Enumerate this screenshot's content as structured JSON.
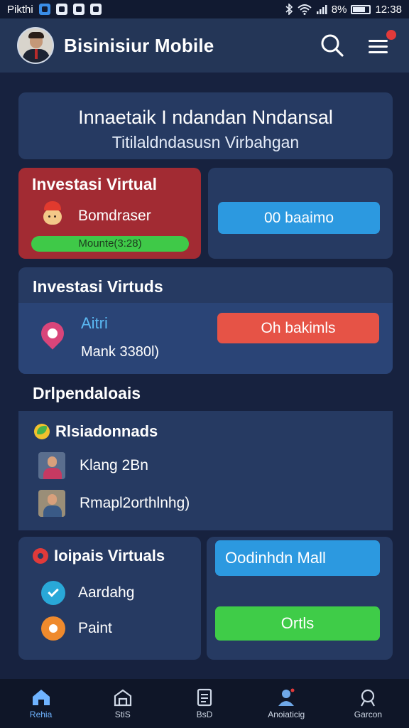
{
  "status_bar": {
    "left_text": "Pikthi",
    "battery": "8%",
    "battery_level": 0.7,
    "time": "12:38"
  },
  "app_bar": {
    "title": "Bisinisiur Mobile"
  },
  "headline": {
    "title": "Innaetaik I ndandan Nndansal",
    "subtitle": "Titilaldndasusn Virbahgan"
  },
  "featured": {
    "title": "Investasi Virtual",
    "item_label": "Bomdraser",
    "pill": "Mounte(3:28)",
    "button": "00 baaimo"
  },
  "investment": {
    "title": "Investasi Virtuds",
    "name": "Aitri",
    "value": "Mank 3380l)",
    "button": "Oh bakimls"
  },
  "section": {
    "title": "Drlpendaloais"
  },
  "list": {
    "header": "Rlsiadonnads",
    "rows": [
      {
        "label": "Klang 2Bn"
      },
      {
        "label": "Rmapl2orthlnhg)"
      }
    ]
  },
  "bottom_left": {
    "title": "Ioipais Virtuals",
    "items": [
      {
        "label": "Aardahg"
      },
      {
        "label": "Paint"
      }
    ]
  },
  "bottom_right": {
    "button_top": "Oodinhdn Mall",
    "button_bottom": "Ortls"
  },
  "nav": [
    {
      "label": "Rehia",
      "icon": "home-icon"
    },
    {
      "label": "StiS",
      "icon": "store-icon"
    },
    {
      "label": "BsD",
      "icon": "document-icon"
    },
    {
      "label": "Anoiaticig",
      "icon": "profile-icon"
    },
    {
      "label": "Garcon",
      "icon": "settings-icon"
    }
  ]
}
